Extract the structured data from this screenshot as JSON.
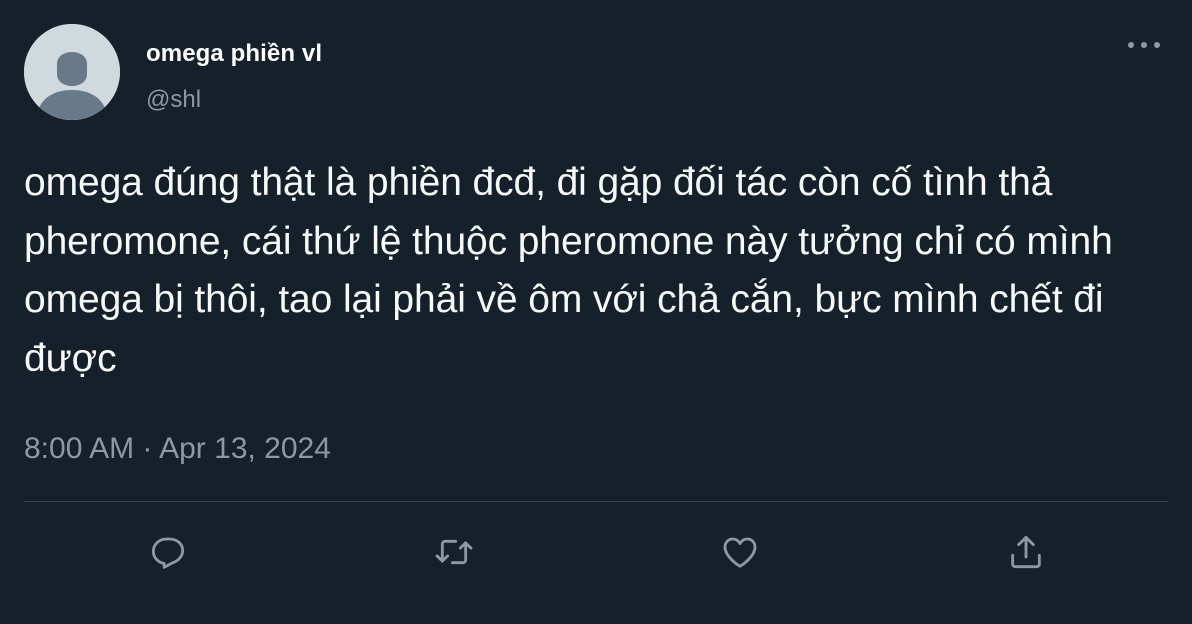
{
  "tweet": {
    "display_name": "omega phiền vl",
    "handle": "@shl",
    "text": "omega đúng thật là phiền đcđ, đi gặp đối tác còn cố tình thả pheromone, cái thứ lệ thuộc pheromone này tưởng chỉ có mình omega bị thôi, tao lại phải về ôm với chả cắn, bực mình chết đi được",
    "time": "8:00 AM",
    "separator": "·",
    "date": "Apr 13, 2024"
  },
  "icons": {
    "more": "more-horizontal-icon",
    "reply": "reply-icon",
    "retweet": "retweet-icon",
    "like": "like-icon",
    "share": "share-icon"
  },
  "colors": {
    "background": "#15202b",
    "text_primary": "#f7f9f9",
    "text_secondary": "#8b98a5",
    "divider": "#38444d",
    "avatar_bg": "#cfd9de",
    "avatar_fg": "#7c8d9c"
  }
}
